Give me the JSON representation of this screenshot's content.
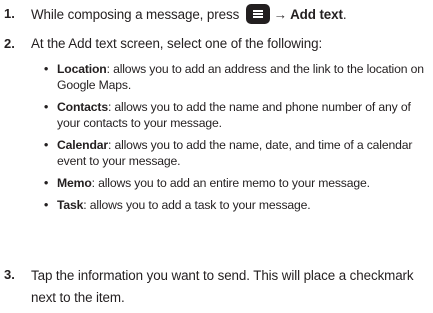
{
  "steps": [
    {
      "number": "1.",
      "text_before": "While composing a message, press",
      "menu_icon": "menu-key-icon",
      "arrow": "→",
      "action": "Add text",
      "period": "."
    },
    {
      "number": "2.",
      "text": "At the Add text screen, select one of the following:"
    },
    {
      "number": "3.",
      "text": "Tap the information you want to send. This will place a checkmark next to the item."
    }
  ],
  "options": [
    {
      "term": "Location",
      "desc": ": allows you to add an address and the link to the location on Google Maps."
    },
    {
      "term": "Contacts",
      "desc": ": allows you to add the name and phone number of any of your contacts to your message."
    },
    {
      "term": "Calendar",
      "desc": ": allows you to add the name, date, and time of a calendar event to your message."
    },
    {
      "term": "Memo",
      "desc": ": allows you to add an entire memo to your message."
    },
    {
      "term": "Task",
      "desc": ": allows you to add a task to your message."
    }
  ],
  "bullet_char": "•"
}
